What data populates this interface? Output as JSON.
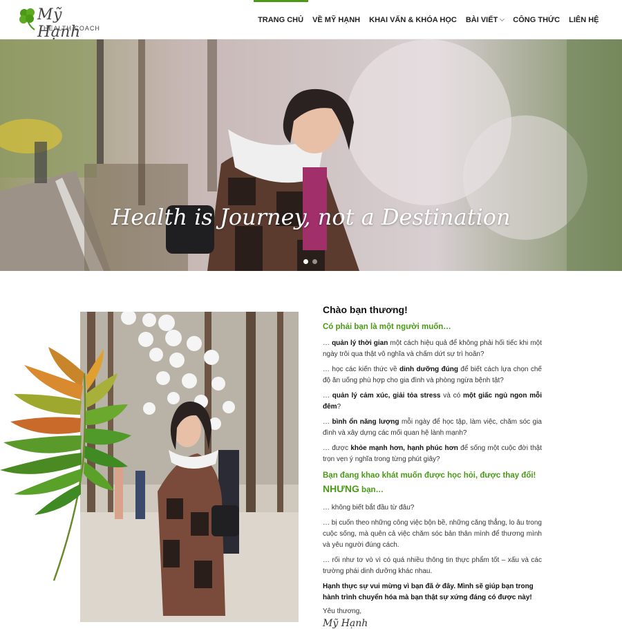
{
  "header": {
    "logo": {
      "script": "Mỹ Hạnh",
      "subtitle": "HEALTH COACH"
    },
    "nav": [
      {
        "label": "TRANG CHỦ",
        "active": true
      },
      {
        "label": "VỀ MỸ HẠNH"
      },
      {
        "label": "KHAI VẤN & KHÓA HỌC"
      },
      {
        "label": "BÀI VIẾT",
        "has_dropdown": true
      },
      {
        "label": "CÔNG THỨC"
      },
      {
        "label": "LIÊN HỆ"
      }
    ],
    "accent_color": "#4a9a17"
  },
  "hero": {
    "caption": "Health is Journey, not a Destination",
    "slides": 2,
    "active_slide": 1
  },
  "intro": {
    "greeting": "Chào bạn thương!",
    "question": "Có phải bạn là một người muốn…",
    "items": [
      {
        "pre": "… ",
        "b1": "quản lý thời gian",
        "mid": " một cách hiệu quả để không phải hối tiếc khi một ngày trôi qua thật vô nghĩa và chấm dứt sự trì hoãn?",
        "b2": "",
        "post": ""
      },
      {
        "pre": "… học các kiến thức về ",
        "b1": "dinh dưỡng đúng",
        "mid": " để biết cách lựa chọn chế độ ăn uống phù hợp cho gia đình và phòng ngừa bệnh tật?",
        "b2": "",
        "post": ""
      },
      {
        "pre": "… ",
        "b1": "quản lý cảm xúc, giải tỏa stress",
        "mid": " và có ",
        "b2": "một giấc ngủ ngon mỗi đêm",
        "post": "?"
      },
      {
        "pre": "… ",
        "b1": "bình ổn năng lượng",
        "mid": " mỗi ngày để học tập, làm việc, chăm sóc gia đình và xây dựng các mối quan hệ lành mạnh?",
        "b2": "",
        "post": ""
      },
      {
        "pre": "… được ",
        "b1": "khỏe mạnh hơn, hạnh phúc hơn",
        "mid": " để sống một cuộc đời thật trọn vẹn ý nghĩa trong từng phút giây?",
        "b2": "",
        "post": ""
      }
    ],
    "desire_line": "Bạn đang khao khát muốn được học hỏi, được thay đổi!",
    "but_word": "NHƯNG",
    "but_rest": " bạn…",
    "problems": [
      "… không biết bắt đầu từ đâu?",
      "… bị cuốn theo những công việc bộn bề, những căng thẳng, lo âu trong cuộc sống, mà quên cả việc chăm sóc bản thân mình để thương mình và yêu người đúng cách.",
      "… rối như tơ vò vì có quá nhiều thông tin thực phẩm tốt – xấu và các trường phái dinh dưỡng khác nhau."
    ],
    "closing": "Hạnh thực sự vui mừng vì bạn đã ở đây. Mình sẽ giúp bạn trong hành trình chuyển hóa mà bạn thật sự xứng đáng có được này!",
    "sign_off": "Yêu thương,",
    "signature": "Mỹ Hạnh"
  }
}
